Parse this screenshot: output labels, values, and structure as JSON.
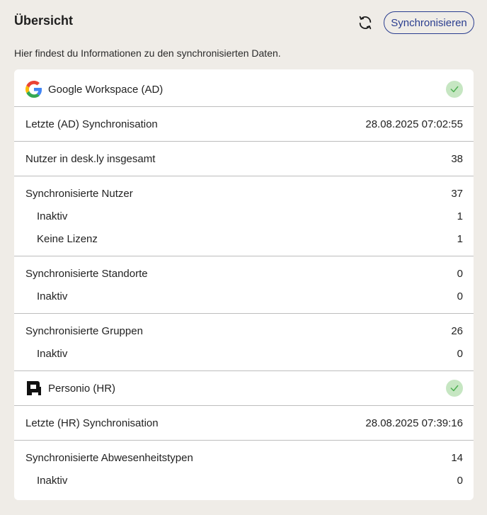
{
  "header": {
    "title": "Übersicht",
    "sync_button_label": "Synchronisieren",
    "subtitle": "Hier findest du Informationen zu den synchronisierten Daten."
  },
  "google": {
    "name": "Google Workspace (AD)",
    "status": "ok",
    "last_sync_label": "Letzte (AD) Synchronisation",
    "last_sync_value": "28.08.2025 07:02:55",
    "total_users_label": "Nutzer in desk.ly insgesamt",
    "total_users_value": "38",
    "synced_users_label": "Synchronisierte Nutzer",
    "synced_users_value": "37",
    "users_inactive_label": "Inaktiv",
    "users_inactive_value": "1",
    "users_no_license_label": "Keine Lizenz",
    "users_no_license_value": "1",
    "synced_locations_label": "Synchronisierte Standorte",
    "synced_locations_value": "0",
    "locations_inactive_label": "Inaktiv",
    "locations_inactive_value": "0",
    "synced_groups_label": "Synchronisierte Gruppen",
    "synced_groups_value": "26",
    "groups_inactive_label": "Inaktiv",
    "groups_inactive_value": "0"
  },
  "personio": {
    "name": "Personio (HR)",
    "status": "ok",
    "last_sync_label": "Letzte (HR) Synchronisation",
    "last_sync_value": "28.08.2025 07:39:16",
    "absence_types_label": "Synchronisierte Abwesenheitstypen",
    "absence_types_value": "14",
    "absence_inactive_label": "Inaktiv",
    "absence_inactive_value": "0"
  },
  "colors": {
    "accent": "#2a3d8f",
    "success_bg": "#c6e6c2",
    "success_check": "#4caf50",
    "page_bg": "#efece7"
  }
}
